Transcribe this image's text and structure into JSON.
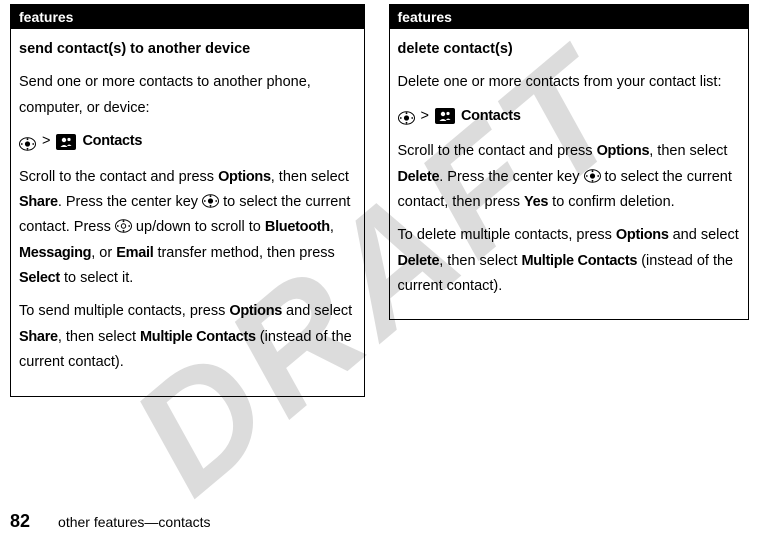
{
  "watermark": "DRAFT",
  "col1": {
    "header": "features",
    "title": "send contact(s) to another device",
    "intro": "Send one or more contacts to another phone, computer, or device:",
    "nav_gt": ">",
    "nav_contacts": "Contacts",
    "p1_a": "Scroll to the contact and press ",
    "p1_options": "Options",
    "p1_b": ", then select ",
    "p1_share": "Share",
    "p1_c": ". Press the center key ",
    "p1_d": " to select the current contact. Press ",
    "p1_e": " up/down to scroll to ",
    "p1_bluetooth": "Bluetooth",
    "p1_f": ", ",
    "p1_messaging": "Messaging",
    "p1_g": ", or ",
    "p1_email": "Email",
    "p1_h": " transfer method, then press ",
    "p1_select": "Select",
    "p1_i": " to select it.",
    "p2_a": "To send multiple contacts, press ",
    "p2_options": "Options",
    "p2_b": " and select ",
    "p2_share": "Share",
    "p2_c": ", then select ",
    "p2_multiple": "Multiple Contacts",
    "p2_d": " (instead of the current contact)."
  },
  "col2": {
    "header": "features",
    "title": "delete contact(s)",
    "intro": "Delete one or more contacts from your contact list:",
    "nav_gt": ">",
    "nav_contacts": "Contacts",
    "p1_a": "Scroll to the contact and press ",
    "p1_options": "Options",
    "p1_b": ", then select ",
    "p1_delete": "Delete",
    "p1_c": ". Press the center key ",
    "p1_d": " to select the current contact, then press ",
    "p1_yes": "Yes",
    "p1_e": " to confirm deletion.",
    "p2_a": "To delete multiple contacts, press ",
    "p2_options": "Options",
    "p2_b": " and select ",
    "p2_delete": "Delete",
    "p2_c": ", then select ",
    "p2_multiple": "Multiple Contacts",
    "p2_d": " (instead of the current contact)."
  },
  "footer": {
    "page": "82",
    "text": "other features—contacts"
  }
}
